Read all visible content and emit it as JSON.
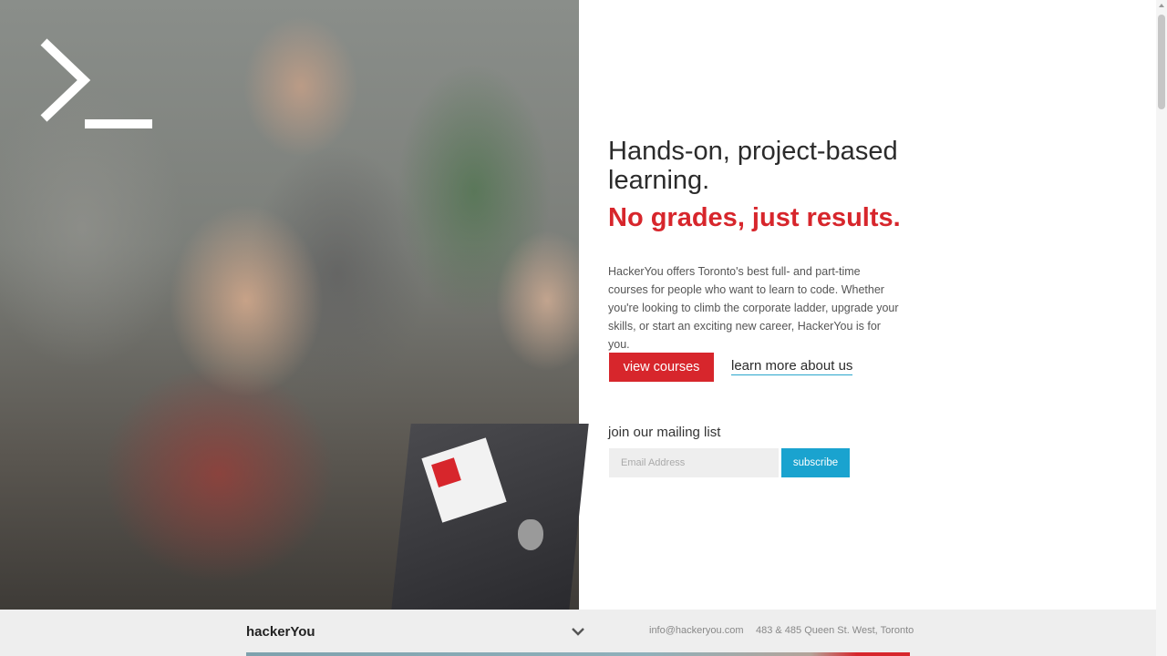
{
  "hero": {
    "headline": "Hands-on, project-based learning.",
    "subheadline": "No grades, just results.",
    "intro": "HackerYou offers Toronto's best full- and part-time courses for people who want to learn to code. Whether you're looking to climb the corporate ladder, upgrade your skills, or start an exciting new career, HackerYou is for you.",
    "primary_button": "view courses",
    "secondary_link": "learn more about us"
  },
  "mailing": {
    "label": "join our mailing list",
    "email_placeholder": "Email Address",
    "subscribe_label": "subscribe"
  },
  "footer": {
    "brand": "hackerYou",
    "email": "info@hackeryou.com",
    "address": "483 & 485 Queen St. West, Toronto"
  },
  "colors": {
    "accent_red": "#d7262c",
    "accent_blue": "#1aa3cf",
    "footer_bg": "#eeeeee"
  },
  "icons": {
    "logo": "terminal-prompt-logo-icon",
    "footer_toggle": "chevron-down-icon",
    "sticker": "hackeryou-logo-sticker"
  }
}
